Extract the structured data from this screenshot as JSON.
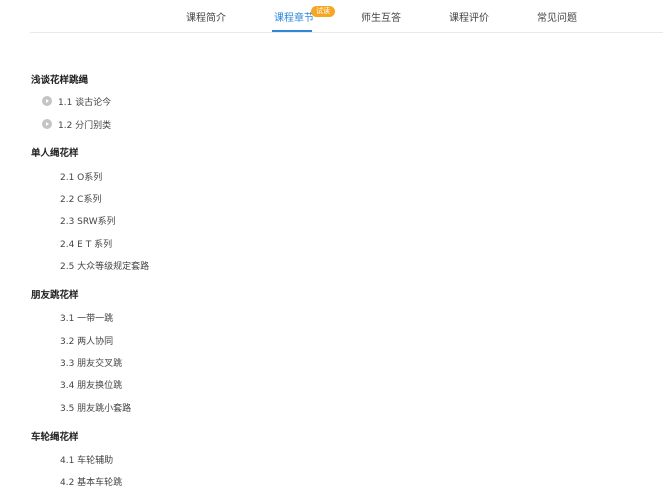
{
  "tabs": [
    {
      "label": "课程简介"
    },
    {
      "label": "课程章节"
    },
    {
      "label": "师生互答"
    },
    {
      "label": "课程评价"
    },
    {
      "label": "常见问题"
    }
  ],
  "trial_badge": "试读",
  "colors": {
    "accent": "#2f87d9",
    "badge": "#f5a623"
  },
  "chapters": [
    {
      "title": "浅谈花样跳绳",
      "lessons": [
        {
          "label": "1.1 谈古论今",
          "icon": "play-circle-icon"
        },
        {
          "label": "1.2 分门别类",
          "icon": "play-circle-icon"
        }
      ]
    },
    {
      "title": "单人绳花样",
      "lessons": [
        {
          "label": "2.1 O系列"
        },
        {
          "label": "2.2 C系列"
        },
        {
          "label": "2.3 SRW系列"
        },
        {
          "label": "2.4 E T 系列"
        },
        {
          "label": "2.5 大众等级规定套路"
        }
      ]
    },
    {
      "title": "朋友跳花样",
      "lessons": [
        {
          "label": "3.1 一带一跳"
        },
        {
          "label": "3.2 两人协同"
        },
        {
          "label": "3.3 朋友交叉跳"
        },
        {
          "label": "3.4 朋友换位跳"
        },
        {
          "label": "3.5 朋友跳小套路"
        }
      ]
    },
    {
      "title": "车轮绳花样",
      "lessons": [
        {
          "label": "4.1 车轮辅助"
        },
        {
          "label": "4.2 基本车轮跳"
        }
      ]
    }
  ]
}
